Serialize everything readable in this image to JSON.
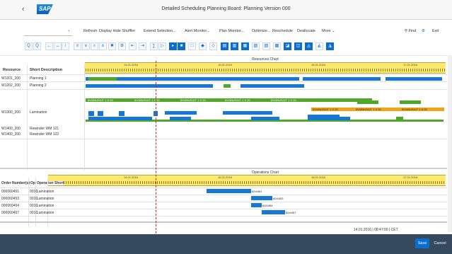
{
  "shell": {
    "back_glyph": "‹",
    "logo_text": "SAP",
    "title": "Detailed Scheduling Planning Board: Planning Version 000"
  },
  "toolbar": {
    "variant_value": "",
    "buttons": [
      "Refresh",
      "Display Hide Shuffler",
      "Extend Selection...",
      "Alert Monitor...",
      "Plan Monitor...",
      "Optimize...",
      "Reschedule",
      "Deallocate",
      "More"
    ],
    "find": "Find",
    "exit": "Exit"
  },
  "icon_toolbar": [
    "Q",
    "Q",
    "←",
    "↔",
    "↕",
    "≡",
    "∨",
    "⌕",
    "∧",
    "✖",
    "⚙",
    "⇤",
    "⇥",
    "∑",
    "▷",
    "▸",
    "■",
    "□",
    "◆",
    "◇",
    "▤",
    "▥",
    "▦",
    "▧",
    "▨",
    "▩",
    "◪",
    "◫",
    "◬",
    "◭",
    "◮"
  ],
  "resource_chart": {
    "section_title": "Resources Chart",
    "col_resource": "Resource",
    "col_desc": "Short Description",
    "dates": [
      "14.01.2016",
      "15.01.2016",
      "16.01.2016",
      "17.01.2016"
    ],
    "rows": [
      {
        "resource": "W1201_200",
        "desc": "Planning 1"
      },
      {
        "resource": "W1202_200",
        "desc": "Planning 2"
      },
      {
        "resource": "W1300_200",
        "desc": "Lamination"
      },
      {
        "resource": "W1400_200",
        "desc": "Rewinder WM 121"
      },
      {
        "resource": "W1400_200",
        "desc": "Rewinder WM 122"
      }
    ],
    "lamination_labels": [
      "5V/4NUS/UT 1 X 20",
      "5V/4NUS/UT 1 X 20",
      "5V/4NUS/UT 1 X 20",
      "5V/4NUS/UT 1 X 20",
      "5V/4NUS/UT 1 X 20"
    ],
    "orange_labels": [
      "5V/4NUS/UT 1 X 20",
      "5V/4NUS/UT 1 X 20",
      "5V/4NUS/UT 1 X 20"
    ]
  },
  "operations_chart": {
    "section_title": "Operations Chart",
    "col_order": "Order Number(s)",
    "col_op": "Op",
    "col_opdesc": "Operation Short",
    "dates": [
      "14.01.2016",
      "15.01.2016",
      "16.01.2016",
      "17.01.2016"
    ],
    "rows": [
      {
        "order": "000060451",
        "op": "0010",
        "desc": "Lamination",
        "bar_label": "60/4451"
      },
      {
        "order": "000060453",
        "op": "0010",
        "desc": "Lamination",
        "bar_label": "60/4453"
      },
      {
        "order": "000060454",
        "op": "0010",
        "desc": "Lamination",
        "bar_label": "60/4454"
      },
      {
        "order": "000060457",
        "op": "0010",
        "desc": "Lamination",
        "bar_label": "60/4457"
      }
    ]
  },
  "status": {
    "date": "14.01.2016",
    "time": "08:47:00",
    "timezone": "CET"
  },
  "footer": {
    "save": "Save",
    "cancel": "Cancel"
  },
  "colors": {
    "shell_bg": "#f7f7f7",
    "footer_bg": "#354a5f",
    "accent": "#0a6ed1",
    "ruler": "#fde96e",
    "bar_blue": "#1678d4",
    "bar_green": "#4fa829",
    "bar_orange": "#f3a318",
    "current_time_line": "#e02020"
  }
}
